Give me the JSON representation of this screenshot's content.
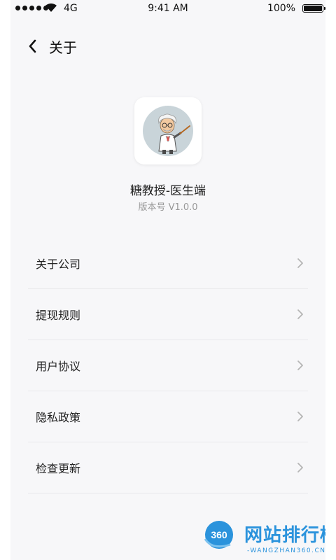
{
  "status_bar": {
    "network": "4G",
    "time": "9:41 AM",
    "battery": "100%"
  },
  "nav": {
    "title": "关于"
  },
  "app": {
    "name": "糖教授-医生端",
    "version": "版本号 V1.0.0"
  },
  "menu": {
    "items": [
      {
        "label": "关于公司"
      },
      {
        "label": "提现规则"
      },
      {
        "label": "用户协议"
      },
      {
        "label": "隐私政策"
      },
      {
        "label": "检查更新"
      }
    ]
  },
  "watermark": {
    "logo_text": "360",
    "text": "网站排行榜",
    "url": "-WANGZHAN360.CN-"
  },
  "icons": {
    "back": "chevron-left-icon",
    "menu_arrow": "chevron-right-icon",
    "wifi": "wifi-icon",
    "battery": "battery-icon",
    "app": "professor-avatar-icon"
  },
  "colors": {
    "background": "#f7f7f9",
    "divider": "#e9e9ec",
    "watermark": "#2b93dc"
  }
}
